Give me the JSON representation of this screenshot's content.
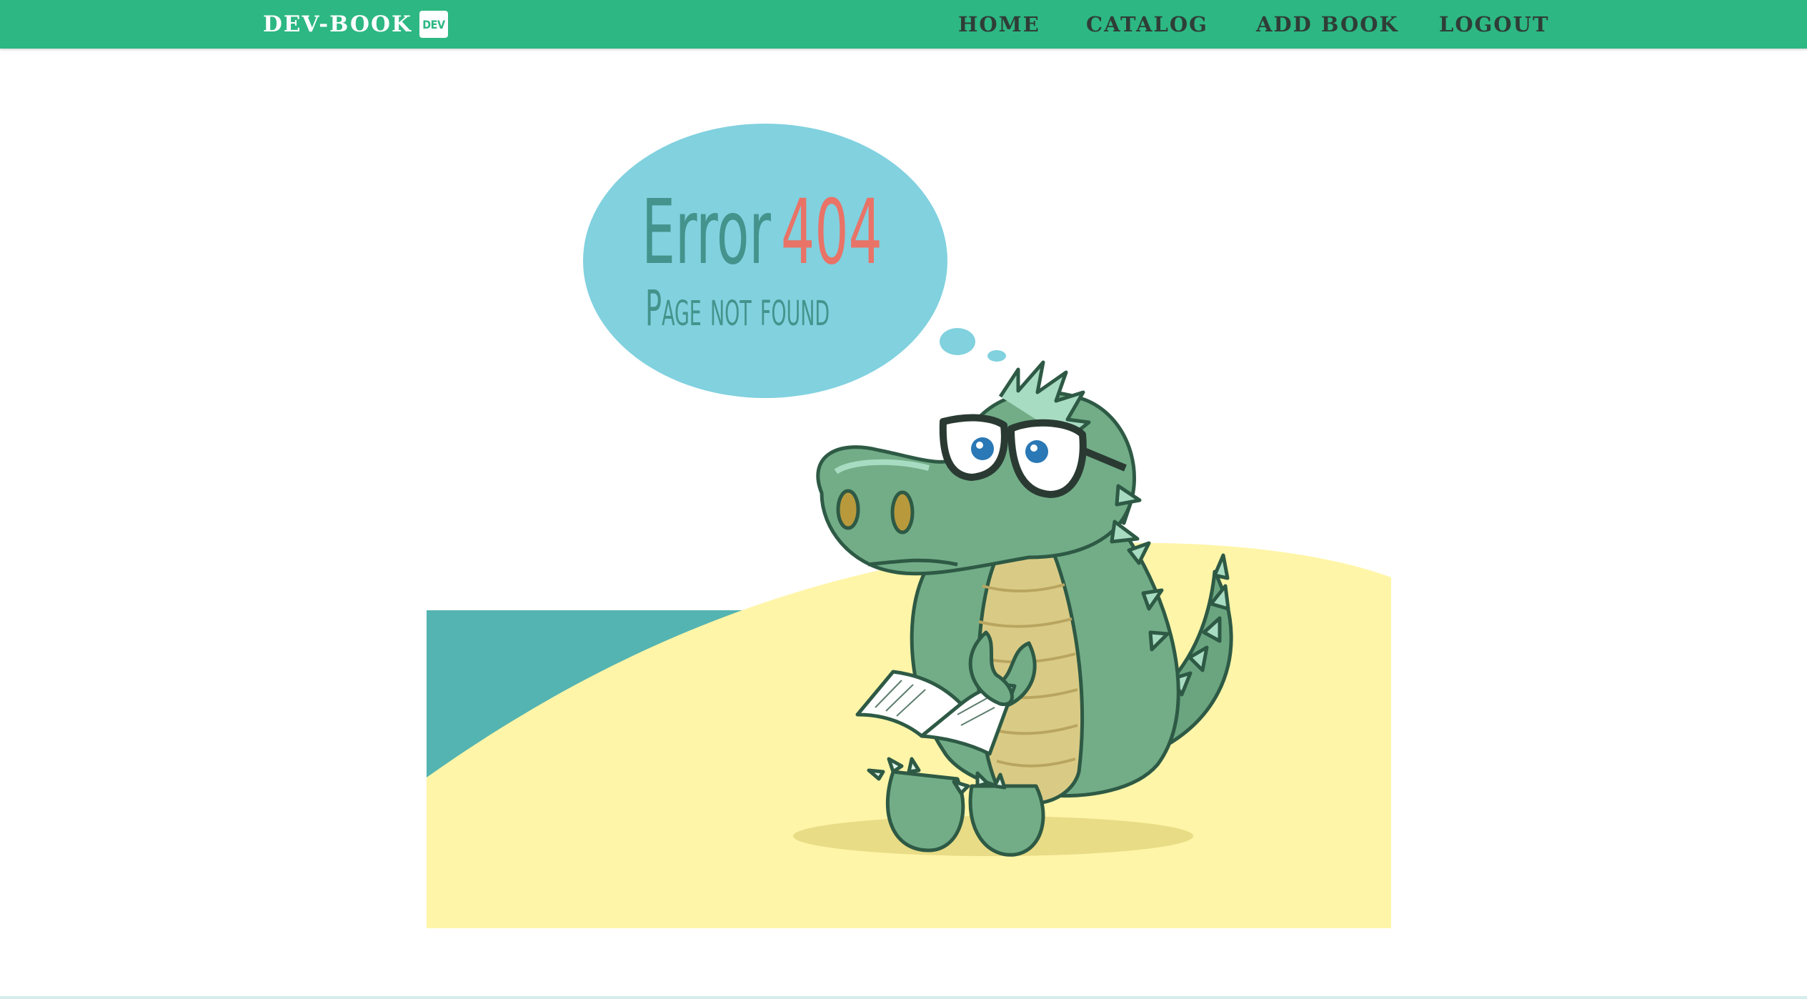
{
  "navbar": {
    "brand": "DEV-BOOK",
    "brand_badge": "DEV",
    "links": [
      "HOME",
      "CATALOG",
      "ADD BOOK",
      "LOGOUT"
    ]
  },
  "error": {
    "title_word": "Error",
    "code": "404",
    "message": "Page not found"
  },
  "colors": {
    "navbar": "#2db783",
    "bubble": "#81d1df",
    "sand": "#fff5a8",
    "sea": "#54b4b1",
    "croc": "#72ad87",
    "error_code": "#e97367",
    "bubble_text": "#44938c"
  },
  "icons": [
    "crocodile-illustration",
    "open-book-icon",
    "glasses-icon",
    "thought-bubble"
  ]
}
